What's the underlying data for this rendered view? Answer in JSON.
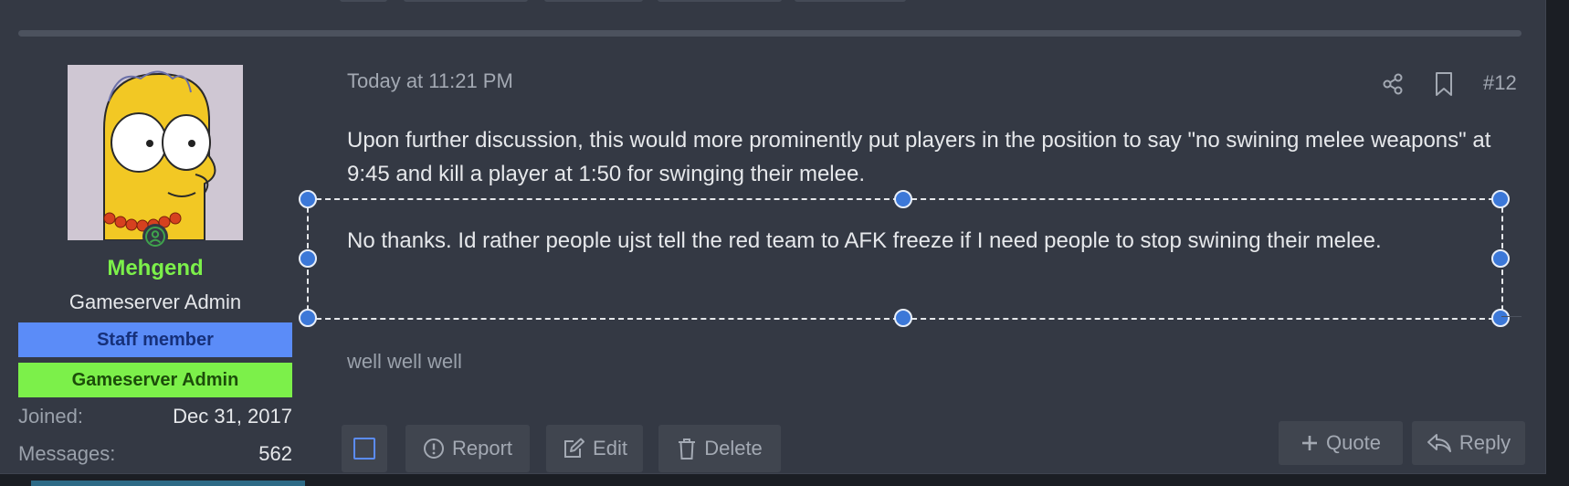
{
  "user": {
    "name": "Mehgend",
    "title": "Gameserver Admin",
    "banners": [
      "Staff member",
      "Gameserver Admin"
    ],
    "stats": [
      {
        "label": "Joined:",
        "value": "Dec 31, 2017"
      },
      {
        "label": "Messages:",
        "value": "562"
      }
    ],
    "avatar_icon": "simpson-avatar",
    "online_icon": "online-status-icon"
  },
  "post": {
    "timestamp": "Today at 11:21 PM",
    "number": "#12",
    "paragraphs": [
      "Upon further discussion, this would more prominently put players in the position to say \"no swining melee weapons\" at 9:45 and kill a player at 1:50 for swinging their melee.",
      "No thanks. Id rather people ujst tell the red team to AFK freeze if I need people to stop swining their melee."
    ],
    "signature": "well well well"
  },
  "actions": {
    "report": "Report",
    "edit": "Edit",
    "delete": "Delete",
    "quote": "Quote",
    "reply": "Reply"
  },
  "colors": {
    "username": "#7cf04a",
    "staff_banner": "#5b8cf8",
    "admin_banner": "#7cf04a",
    "selection_handle": "#3c78d8"
  }
}
